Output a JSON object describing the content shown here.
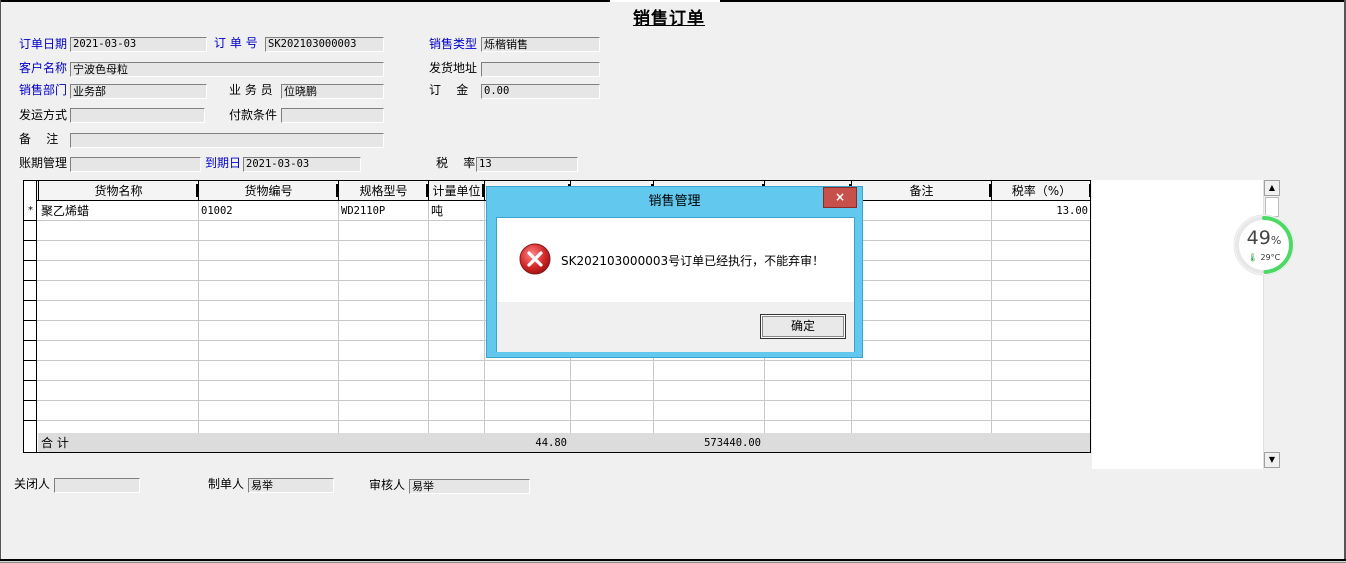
{
  "form": {
    "title": "销售订单",
    "order_date": {
      "label": "订单日期",
      "value": "2021-03-03"
    },
    "order_no": {
      "label": "订 单 号",
      "value": "SK202103000003"
    },
    "sales_type": {
      "label": "销售类型",
      "value": "烁楷销售"
    },
    "customer": {
      "label": "客户名称",
      "value": "宁波色母粒"
    },
    "ship_address": {
      "label": "发货地址",
      "value": ""
    },
    "sales_dept": {
      "label": "销售部门",
      "value": "业务部"
    },
    "salesman": {
      "label": "业 务 员",
      "value": "位晓鹏"
    },
    "deposit": {
      "label": "订    金",
      "value": "0.00"
    },
    "ship_method": {
      "label": "发运方式",
      "value": ""
    },
    "payment_terms": {
      "label": "付款条件",
      "value": ""
    },
    "remarks": {
      "label": "备    注",
      "value": ""
    },
    "account_period": {
      "label": "账期管理",
      "value": ""
    },
    "due_date": {
      "label": "到期日",
      "value": "2021-03-03"
    },
    "tax_rate": {
      "label": "税    率",
      "value": "13"
    }
  },
  "grid": {
    "columns": [
      "货物名称",
      "货物编号",
      "规格型号",
      "计量单位",
      "",
      "",
      "",
      "",
      "备注",
      "税率（%）"
    ],
    "rows": [
      {
        "marker": "*",
        "name": "聚乙烯蜡",
        "code": "01002",
        "spec": "WD2110P",
        "unit": "吨",
        "tax": "13.00"
      }
    ],
    "total": {
      "label": "合    计",
      "quantity": "44.80",
      "amount": "573440.00"
    }
  },
  "footer": {
    "closer": {
      "label": "关闭人",
      "value": ""
    },
    "creator": {
      "label": "制单人",
      "value": "易举"
    },
    "reviewer": {
      "label": "审核人",
      "value": "易举"
    }
  },
  "widget": {
    "percent": "49",
    "percent_unit": "%",
    "temperature": "29°C",
    "fraction": 0.49
  },
  "dialog": {
    "title": "销售管理",
    "message": "SK202103000003号订单已经执行，不能弃审！",
    "ok_label": "确定",
    "close_label": "×"
  },
  "colors": {
    "dialog_frame": "#63c8ee",
    "close_button": "#c7504b",
    "label_blue": "#0000c8",
    "gauge_green": "#4cd964"
  }
}
